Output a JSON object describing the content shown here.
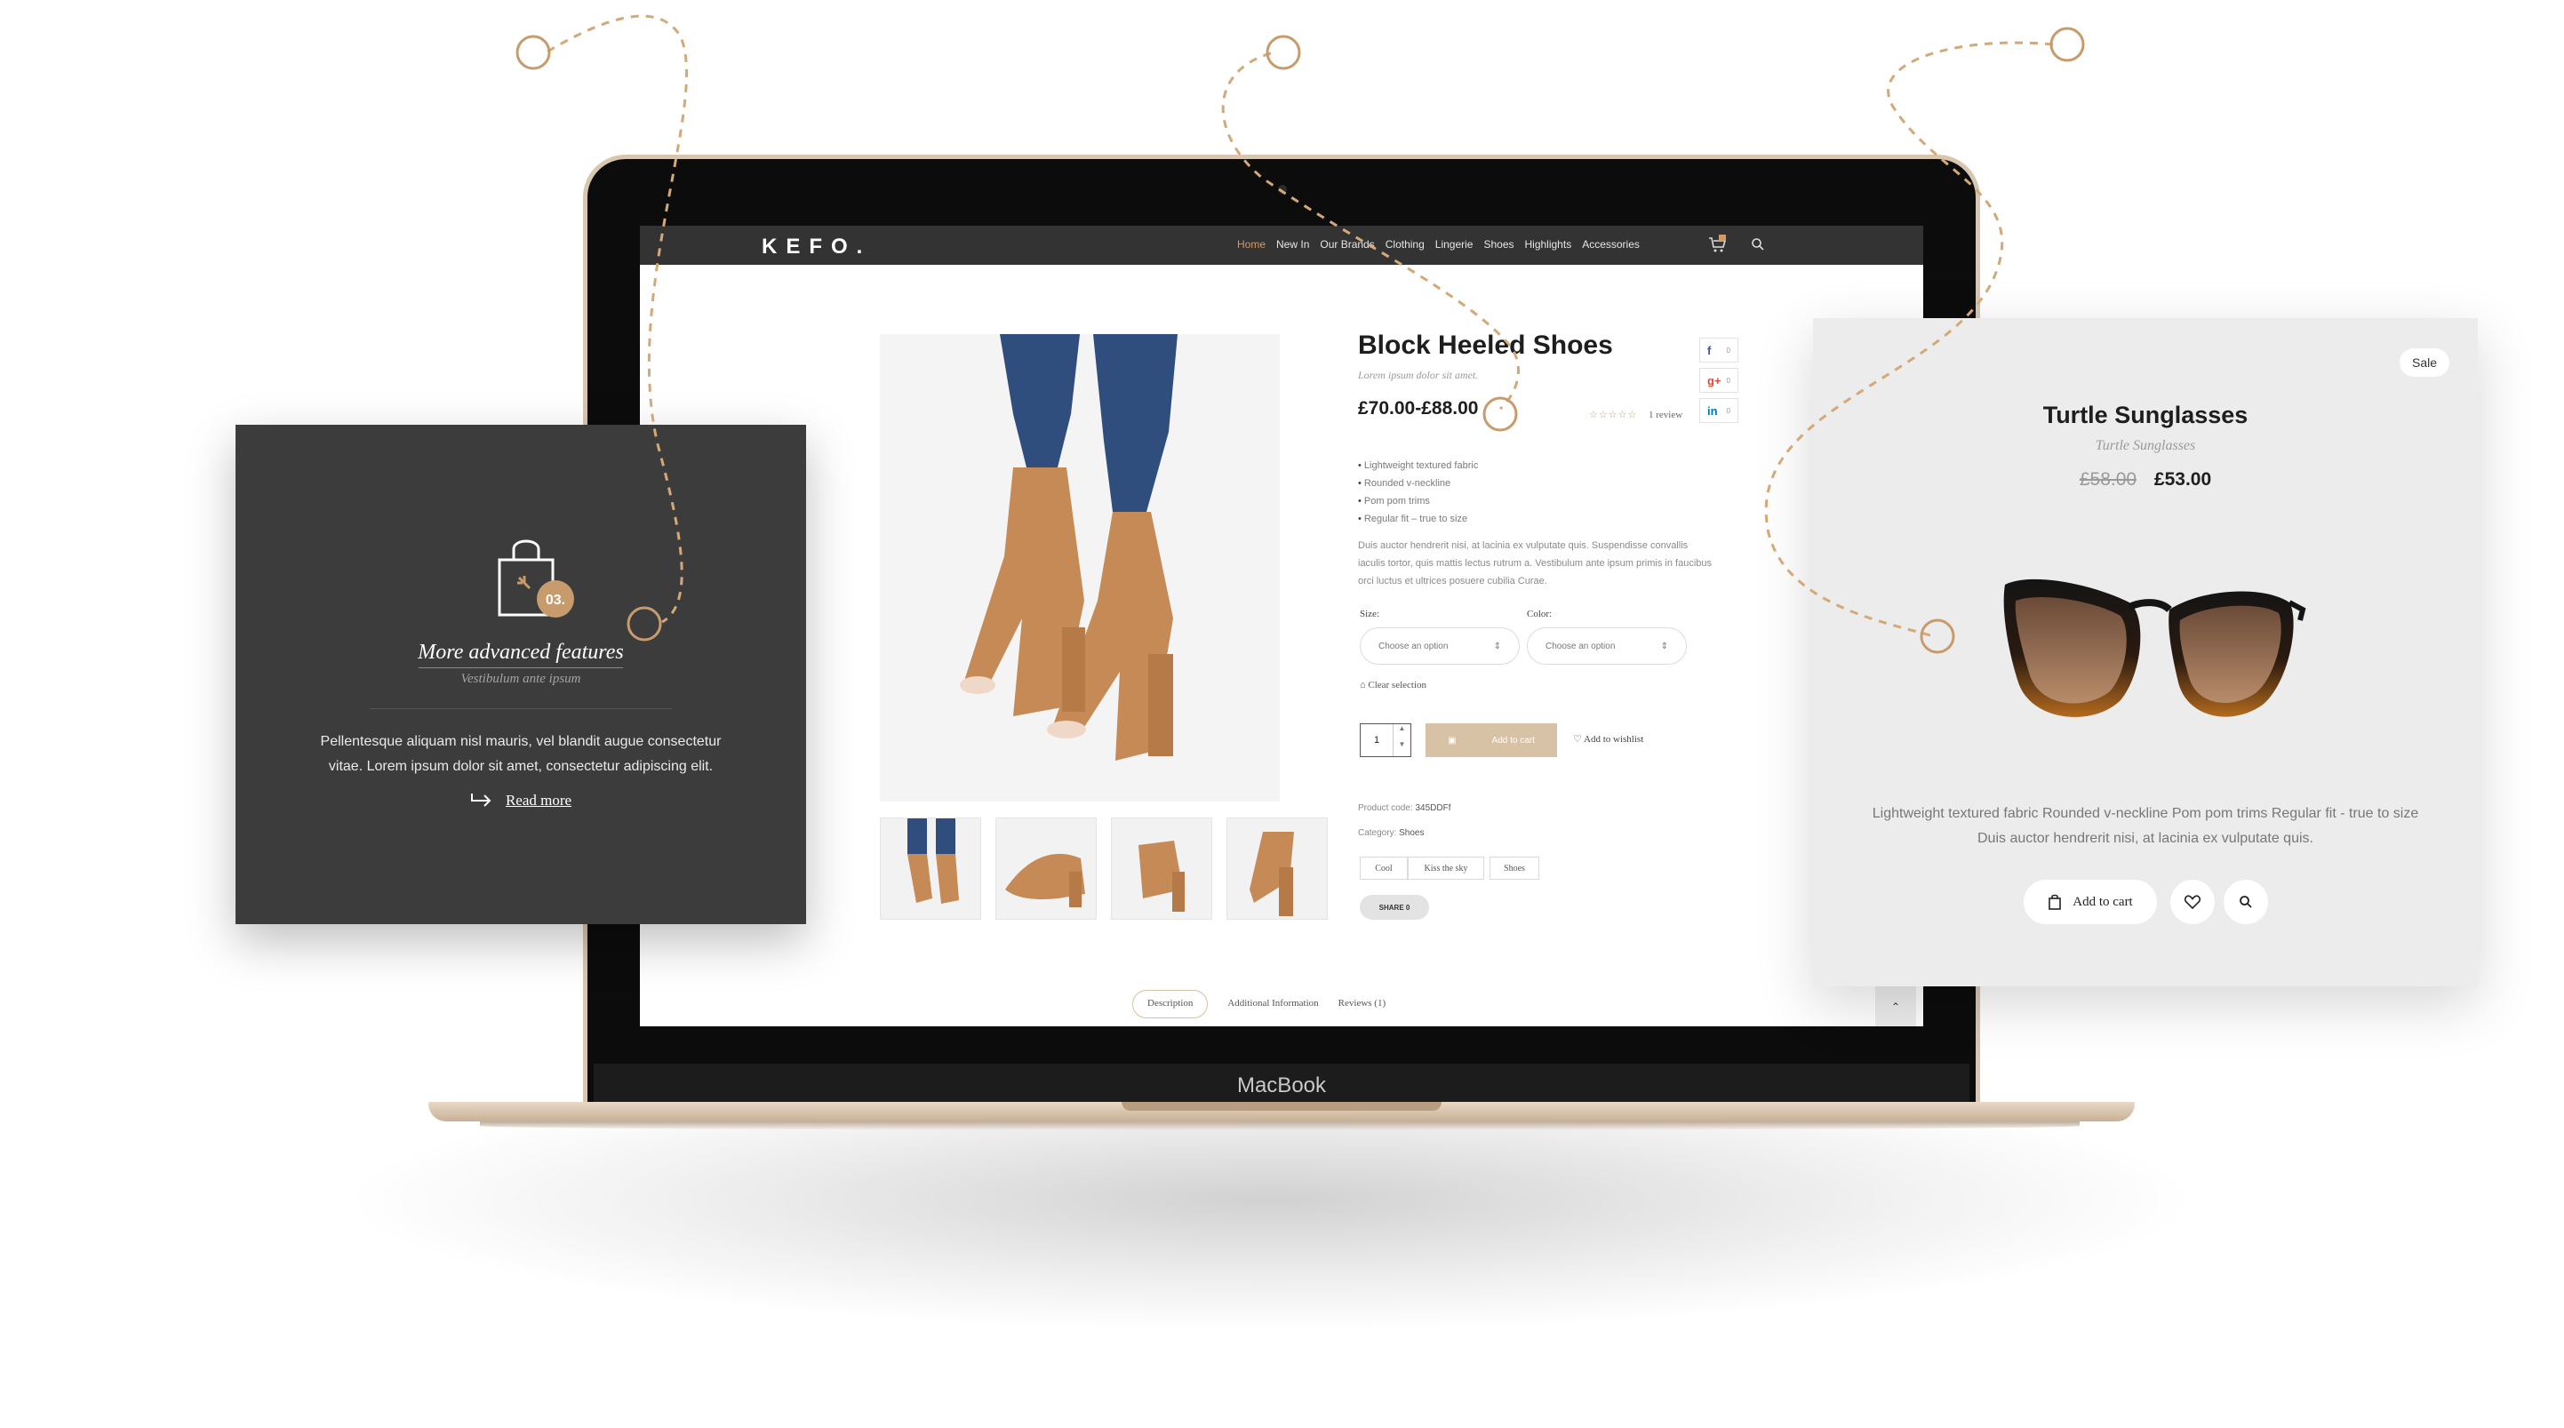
{
  "laptop": {
    "brand_label": "MacBook"
  },
  "site": {
    "logo": "KEFO.",
    "menu": [
      "Home",
      "New In",
      "Our Brands",
      "Clothing",
      "Lingerie",
      "Shoes",
      "Highlights",
      "Accessories"
    ],
    "active_menu": "Home",
    "accent_color": "#d09b66"
  },
  "product": {
    "title": "Block Heeled Shoes",
    "subtitle": "Lorem ipsum dolor sit amet.",
    "price": "£70.00-£88.00",
    "rating_stars": "☆☆☆☆☆",
    "review_link": "1 review",
    "share": [
      {
        "icon": "facebook-icon",
        "glyph": "f",
        "count": "0",
        "color": "#3b5998"
      },
      {
        "icon": "google-plus-icon",
        "glyph": "g+",
        "count": "0",
        "color": "#dd4b39"
      },
      {
        "icon": "linkedin-icon",
        "glyph": "in",
        "count": "0",
        "color": "#0077b5"
      }
    ],
    "features": [
      "Lightweight textured fabric",
      "Rounded v-neckline",
      "Pom pom trims",
      "Regular fit – true to size"
    ],
    "description": "Duis auctor hendrerit nisi, at lacinia ex vulputate quis. Suspendisse convallis iaculis tortor, quis mattis lectus rutrum a. Vestibulum ante ipsum primis in faucibus orci luctus et ultrices posuere cubilia Curae.",
    "size_label": "Size:",
    "color_label": "Color:",
    "size_placeholder": "Choose an option",
    "color_placeholder": "Choose an option",
    "clear_selection": "Clear selection",
    "quantity": "1",
    "add_to_cart": "Add to cart",
    "add_to_wishlist": "Add to wishlist",
    "product_code_label": "Product code:",
    "product_code": "345DDFf",
    "category_label": "Category:",
    "category": "Shoes",
    "tags": [
      "Cool",
      "Kiss the sky",
      "Shoes"
    ],
    "share_button": "SHARE 0",
    "tabs": [
      "Description",
      "Additional Information",
      "Reviews (1)"
    ],
    "active_tab": "Description",
    "scroll_top": "⌃"
  },
  "feature_card": {
    "badge": "03.",
    "title": "More advanced features",
    "subtitle": "Vestibulum ante ipsum",
    "text": "Pellentesque aliquam nisl mauris, vel blandit augue consectetur vitae. Lorem ipsum dolor sit amet, consectetur adipiscing elit.",
    "link": "Read more"
  },
  "product_card": {
    "badge": "Sale",
    "title": "Turtle Sunglasses",
    "subtitle": "Turtle Sunglasses",
    "old_price": "£58.00",
    "new_price": "£53.00",
    "description": "Lightweight textured fabric Rounded v-neckline Pom pom trims Regular fit - true to size Duis auctor hendrerit nisi, at lacinia ex vulputate quis.",
    "add_to_cart": "Add to cart"
  }
}
